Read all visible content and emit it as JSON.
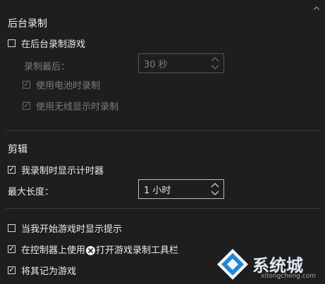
{
  "background_recording": {
    "title": "后台录制",
    "record_in_background_label": "在后台录制游戏",
    "record_last_label": "录制最后：",
    "record_last_value": "30 秒",
    "use_battery_label": "使用电池时录制",
    "use_wireless_display_label": "使用无线显示时录制"
  },
  "clip": {
    "title": "剪辑",
    "show_timer_label": "我录制时显示计时器",
    "max_length_label": "最大长度：",
    "max_length_value": "1 小时"
  },
  "tips": {
    "show_tips_label": "当我开始游戏时显示提示",
    "open_toolbar_prefix": "在控制器上使用",
    "open_toolbar_suffix": "打开游戏录制工具栏",
    "remember_as_game_label": "将其记为游戏"
  },
  "watermark": {
    "brand_text": "系统城",
    "url_text": "xitongcheng.com"
  },
  "colors": {
    "background": "#1e1e1e",
    "text": "#e6e6e6",
    "disabled_text": "#7d7d7d",
    "watermark_blue": "#1e88d8"
  }
}
